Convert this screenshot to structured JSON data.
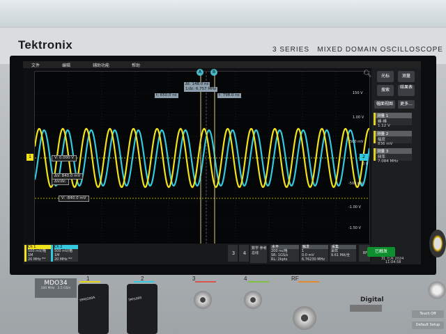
{
  "device": {
    "brand": "Tektronix",
    "series": "3 SERIES",
    "subtitle": "MIXED DOMAIN OSCILLOSCOPE",
    "model": "MDO34",
    "model_spec_1": "100 MHz",
    "model_spec_2": "2.5 GS/s"
  },
  "menu": [
    "文件",
    "编辑",
    "辅助功能",
    "帮助"
  ],
  "cursors": {
    "delta_t": "Δt:   148.0 ns",
    "inv_delta_t": "1/Δt: 6.757 MHz",
    "t1": "t:    650.0 ns",
    "t2": "t:    798.0 ns",
    "cursor_a": "A",
    "cursor_b": "B",
    "v1": "V:    0.000 V",
    "delta_v": "ΔV:     840.0 mV",
    "dv_dt": "ΔV/Δt:",
    "v2": "V:   -840.0 mV"
  },
  "axis_labels": [
    "150 V",
    "1.00 V",
    "500 mV",
    "0 V",
    "-500 mV",
    "-1.00 V",
    "-1.50 V"
  ],
  "right_panel": {
    "buttons": [
      "光标",
      "测量",
      "搜索",
      "结果表",
      "幅面视图",
      "更多..."
    ],
    "meas1": {
      "title": "测量 1",
      "sub": "峰-峰",
      "value": "1.12 V"
    },
    "meas2": {
      "title": "测量 2",
      "sub": "幅度",
      "value": "836 mV"
    },
    "meas3": {
      "title": "测量 3",
      "sub": "频率",
      "value": "7.084 MHz"
    }
  },
  "bottom": {
    "ch1": {
      "title": "Ch 1",
      "l1": "500 mV/格",
      "l2": "1M",
      "l3": "20 MHz ᴮᵂ"
    },
    "ch2": {
      "title": "Ch 2",
      "l1": "500 mV/格",
      "l2": "1M",
      "l3": "20 MHz ᴮᵂ"
    },
    "btn3": "3",
    "btn4": "4",
    "btn_math": "数学 参考 总线",
    "horizontal": {
      "title": "水平",
      "l1": "200 ns/格",
      "l2": "SR: 1GS/s",
      "l3": "RL: 2kpts"
    },
    "trigger": {
      "title": "触发",
      "l1": "1",
      "l2": "0.0 mV",
      "l3": "6.76230 MHz"
    },
    "acq": {
      "title": "采集",
      "l1": "采样",
      "l2": "9.61 MA/全"
    },
    "rf": "RF",
    "run": "已触发",
    "date": "31 七月 2024",
    "time": "11:04:58"
  },
  "front": {
    "ch_labels": [
      "1",
      "2",
      "3",
      "4",
      "RF",
      "Digital"
    ],
    "probe1_text": "TPP0200A",
    "probe2_text": "TPP1000",
    "touch_off": "Touch Off",
    "default_setup": "Default Setup"
  },
  "colors": {
    "ch1": "#f0e21c",
    "ch2": "#34c9de",
    "cursor": "#d8c45a"
  }
}
